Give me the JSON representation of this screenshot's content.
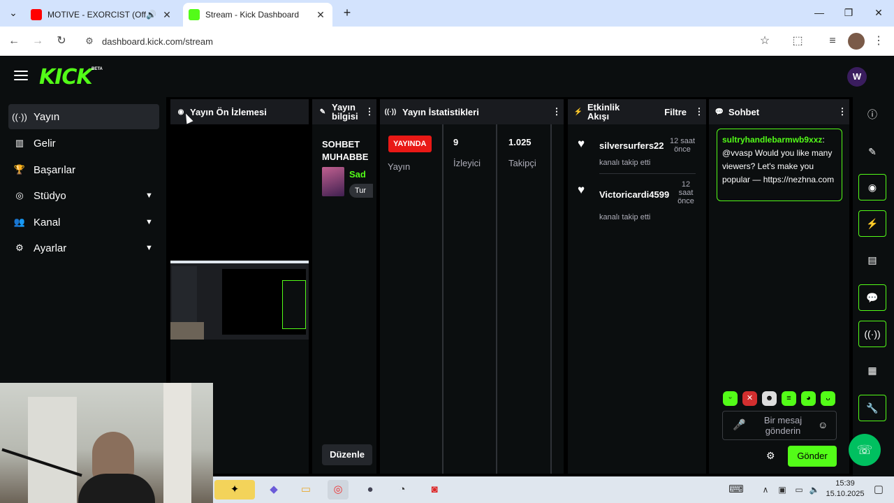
{
  "browser": {
    "tabs": [
      {
        "title": "MOTIVE - EXORCIST (Official",
        "favicon_color": "#ff0000"
      },
      {
        "title": "Stream - Kick Dashboard",
        "favicon_color": "#53fc18"
      }
    ],
    "url": "dashboard.kick.com/stream"
  },
  "header": {
    "logo": "KICK",
    "beta": "BETA",
    "avatar_letter": "W"
  },
  "sidebar": {
    "items": [
      {
        "label": "Yayın",
        "icon": "stream-icon"
      },
      {
        "label": "Gelir",
        "icon": "chart-icon"
      },
      {
        "label": "Başarılar",
        "icon": "trophy-icon"
      },
      {
        "label": "Stüdyo",
        "icon": "studio-icon"
      },
      {
        "label": "Kanal",
        "icon": "users-icon"
      },
      {
        "label": "Ayarlar",
        "icon": "gear-icon"
      }
    ]
  },
  "preview": {
    "title": "Yayın Ön İzlemesi"
  },
  "info": {
    "title_line1": "Yayın",
    "title_line2": "bilgisi",
    "stream_title_line1": "SOHBET",
    "stream_title_line2": "MUHABBE",
    "category": "Sad",
    "tag": "Tur",
    "edit_button": "Düzenle"
  },
  "stats": {
    "title": "Yayın İstatistikleri",
    "live_badge": "YAYINDA",
    "status_label": "Yayın",
    "viewers_value": "9",
    "viewers_label": "İzleyici",
    "followers_value": "1.025",
    "followers_label": "Takipçi"
  },
  "activity": {
    "title_line1": "Etkinlik",
    "title_line2": "Akışı",
    "filter": "Filtre",
    "events": [
      {
        "user": "silversurfers22",
        "time_line1": "12 saat",
        "time_line2": "önce",
        "text": "kanalı takip etti"
      },
      {
        "user": "Victoricardi4599",
        "time_line1": "12",
        "time_line2": "saat",
        "time_line3": "önce",
        "text": "kanalı takip etti"
      }
    ]
  },
  "chat": {
    "title": "Sohbet",
    "message_user": "sultryhandlebarmwb9xxz",
    "message_text": "@vvasp Would you like many viewers? Let's make you popular — https://nezhna.com",
    "input_placeholder": "Bir mesaj gönderin",
    "send_button": "Gönder"
  },
  "taskbar": {
    "time": "15:39",
    "date": "15.10.2025"
  },
  "colors": {
    "accent": "#53fc18",
    "live": "#e91916",
    "panel": "#0b0e0f",
    "panel_header": "#191b1f"
  }
}
